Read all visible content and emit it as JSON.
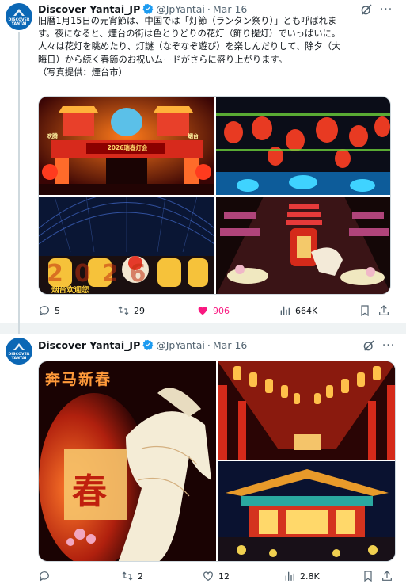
{
  "tweets": [
    {
      "author_name": "Discover Yantai_JP",
      "handle": "@JpYantai",
      "separator": "·",
      "date": "Mar 16",
      "avatar_text": [
        "DISCOVER",
        "YANTAI"
      ],
      "text_lines": [
        "旧暦1月15日の元宵節は、中国では「灯節（ランタン祭り）」とも呼ばれま",
        "す。夜になると、煙台の街は色とりどりの花灯（飾り提灯）でいっぱいに。",
        "人々は花灯を眺めたり、灯謎（なぞなぞ遊び）を楽しんだりして、除夕（大",
        "晦日）から続く春節のお祝いムードがさらに盛り上がります。",
        "（写真提供：煙台市）"
      ],
      "image_texts": {
        "gate_banner": "2026瑞春灯会",
        "gate_side_left": "欢腾",
        "gate_side_right": "烟台",
        "big_number": "2026",
        "caption": "烟台欢迎您"
      },
      "replies": "5",
      "reposts": "29",
      "likes": "906",
      "views": "664K"
    },
    {
      "author_name": "Discover Yantai_JP",
      "handle": "@JpYantai",
      "separator": "·",
      "date": "Mar 16",
      "avatar_text": [
        "DISCOVER",
        "YANTAI"
      ],
      "image_texts": {
        "calligraphy": "奔马新春",
        "lantern_char": "春"
      },
      "replies": "",
      "reposts": "2",
      "likes": "12",
      "views": "2.8K"
    }
  ],
  "colors": {
    "verified": "#1d9bf0",
    "like": "#f91880",
    "muted": "#536471",
    "avatar": "#0b67b5"
  },
  "icons": [
    "verified-badge-icon",
    "grok-icon",
    "more-icon",
    "reply-icon",
    "repost-icon",
    "heart-icon",
    "views-icon",
    "bookmark-icon",
    "share-icon"
  ]
}
